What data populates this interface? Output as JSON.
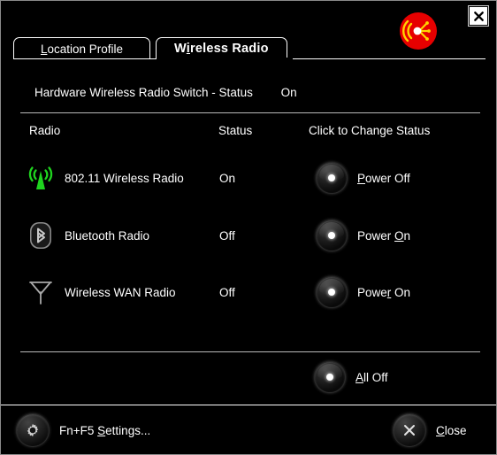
{
  "window": {
    "close_label": "x",
    "logo_name": "wireless-broadcast-logo",
    "accent_red": "#e60000",
    "accent_yellow": "#ffd400",
    "wifi_green": "#1fd41f",
    "text_color": "#ffffff"
  },
  "tabs": [
    {
      "label": "Location Profile",
      "accel": "L",
      "active": false
    },
    {
      "label": "Wireless Radio",
      "accel": "i",
      "active": true
    }
  ],
  "hardware_switch": {
    "label": "Hardware Wireless Radio Switch - Status",
    "value": "On"
  },
  "table": {
    "headers": {
      "radio": "Radio",
      "status": "Status",
      "change": "Click to Change Status"
    },
    "rows": [
      {
        "icon": "wifi-antenna-icon",
        "name": "802.11 Wireless Radio",
        "status": "On",
        "action": "Power Off",
        "accel": "P"
      },
      {
        "icon": "bluetooth-icon",
        "name": "Bluetooth Radio",
        "status": "Off",
        "action": "Power On",
        "accel": "O"
      },
      {
        "icon": "wwan-antenna-icon",
        "name": "Wireless WAN Radio",
        "status": "Off",
        "action": "Power On",
        "accel": "r"
      }
    ]
  },
  "all_off": {
    "label": "All Off",
    "accel": "A"
  },
  "footer": {
    "settings_label": "Fn+F5 Settings...",
    "settings_accel": "S",
    "close_label": "Close",
    "close_accel": "C"
  }
}
